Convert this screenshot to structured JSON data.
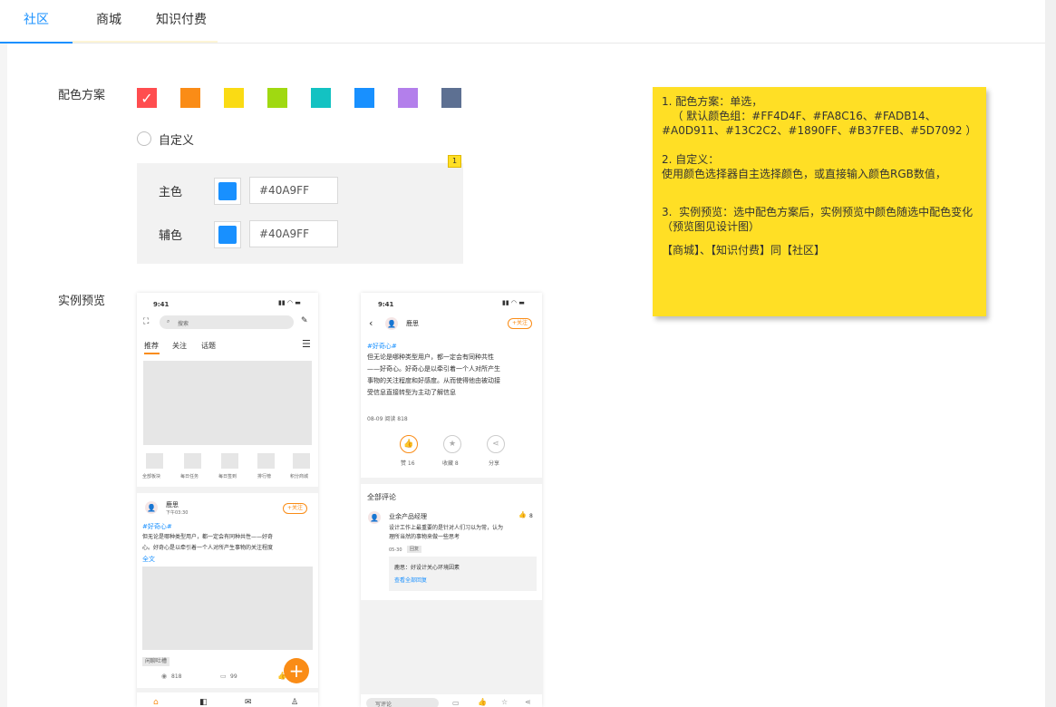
{
  "tabs": [
    {
      "label": "社区",
      "active": true
    },
    {
      "label": "商城",
      "active": false
    },
    {
      "label": "知识付费",
      "active": false
    }
  ],
  "scheme": {
    "label": "配色方案",
    "colors": [
      "#FF4D4F",
      "#FA8C16",
      "#FADB14",
      "#A0D911",
      "#13C2C2",
      "#1890FF",
      "#B37FEB",
      "#5D7092"
    ],
    "selected_index": 0
  },
  "custom": {
    "label": "自定义",
    "primary_label": "主色",
    "primary_value": "#40A9FF",
    "secondary_label": "辅色",
    "secondary_value": "#40A9FF",
    "swatch_color": "#1890FF",
    "note_badge": "1"
  },
  "preview": {
    "label": "实例预览"
  },
  "sticky": {
    "line1": "1. 配色方案：单选，\n   （ 默认颜色组：#FF4D4F、#FA8C16、#FADB14、\n#A0D911、#13C2C2、#1890FF、#B37FEB、#5D7092 ）",
    "line2": "2. 自定义：\n使用颜色选择器自主选择颜色，或直接输入颜色RGB数值，",
    "line3": "3.  实例预览：选中配色方案后，实例预览中颜色随选中配色变化（预览图见设计图）",
    "line4": "【商城】、【知识付费】同【社区】"
  },
  "phone1": {
    "time": "9:41",
    "search": "搜索",
    "tabs": [
      "推荐",
      "关注",
      "话题"
    ],
    "menu": [
      "全部板块",
      "每日任务",
      "每日签到",
      "排行榜",
      "积分商城"
    ],
    "author": "鹿思",
    "post_time": "下午03:30",
    "follow": "+关注",
    "topic": "#好奇心#",
    "body": "但无论是哪种类型用户，都一定会有同种共性——好奇\n心。好奇心是以牵引着一个人对所产生事物的关注程度",
    "more": "全文",
    "tag": "闲聊吐槽",
    "views": "818",
    "comments": "99"
  },
  "phone2": {
    "time": "9:41",
    "author": "鹿思",
    "follow": "+关注",
    "topic": "#好奇心#",
    "body": "但无论是哪种类型用户，都一定会有同种共性\n——好奇心。好奇心是以牵引着一个人对所产生\n事物的关注程度和好感度。从而使得他由被动接\n受信息直接转型为主动了解信息",
    "meta": "08-09  阅读 818",
    "actions": [
      "赞 16",
      "收藏 8",
      "分享"
    ],
    "comments_title": "全部评论",
    "commenter": "业余产品经理",
    "likes": "8",
    "comment": "设计工作上最重要的是针对人们习以为常，认为\n理所当然的事物来做一些思考",
    "comment_date": "05-30",
    "reply_tag": "回复",
    "reply": "鹿思：好设计关心环境因素",
    "view_all": "查看全部回复",
    "input": "写评论"
  }
}
